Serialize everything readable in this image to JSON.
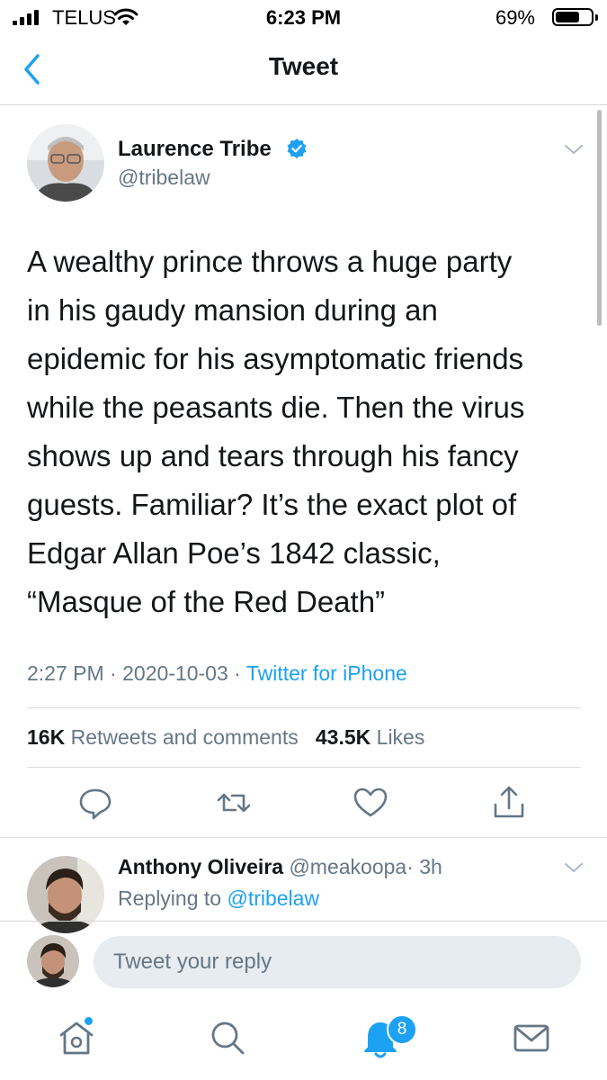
{
  "status_bar": {
    "carrier": "TELUS",
    "time": "6:23 PM",
    "battery": "69%",
    "battery_level": 0.69
  },
  "nav": {
    "title": "Tweet",
    "back_icon": "chevron-left-icon"
  },
  "tweet": {
    "author_name": "Laurence Tribe",
    "author_handle": "@tribelaw",
    "verified": true,
    "lines": [
      "A wealthy prince throws a huge party",
      "in his gaudy mansion during an",
      "epidemic for his asymptomatic friends",
      "while the peasants die. Then the virus",
      "shows up and tears through his fancy",
      "guests. Familiar? It’s the exact plot of",
      "Edgar Allan Poe’s 1842 classic,",
      "“Masque of the Red Death”"
    ],
    "time": "2:27 PM",
    "date": "2020-10-03",
    "separator": "·",
    "source": "Twitter for iPhone",
    "retweets_count": "16K",
    "retweets_label": "Retweets and comments",
    "likes_count": "43.5K",
    "likes_label": "Likes"
  },
  "actions": [
    "comment-icon",
    "retweet-icon",
    "like-icon",
    "share-icon"
  ],
  "reply": {
    "author_name": "Anthony Oliveira",
    "author_handle": "@meakoopa",
    "separator": "·",
    "age": "3h",
    "replying_prefix": "Replying to",
    "replying_to": "@tribelaw"
  },
  "compose": {
    "placeholder": "Tweet your reply"
  },
  "tab_bar": {
    "items": [
      "home-icon",
      "search-icon",
      "notifications-icon",
      "messages-icon"
    ],
    "notifications_badge": "8"
  },
  "colors": {
    "accent": "#1da1f2",
    "text": "#14171a",
    "secondary": "#657786",
    "input_bg": "#e6ecf0"
  }
}
